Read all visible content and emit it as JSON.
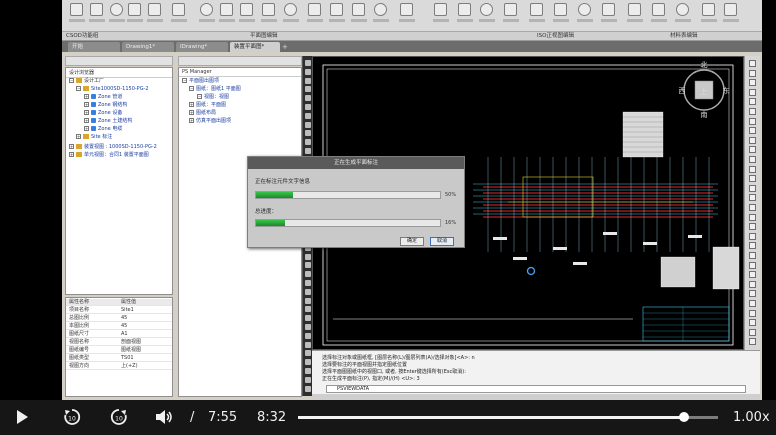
{
  "ribbon": {
    "groups": [
      "CSOD功能组",
      "平面图编辑",
      "ISO正视图编辑",
      "材料表编辑"
    ]
  },
  "tabs": [
    {
      "label": "开始"
    },
    {
      "label": "Drawing1*"
    },
    {
      "label": "IDrawing*"
    },
    {
      "label": "装置平面图*"
    }
  ],
  "tree1": {
    "title": "设计浏览器",
    "nodes": [
      {
        "label": "设计工厂"
      },
      {
        "label": "Site1000SD-1150-PG-2"
      },
      {
        "label": "Zone 管道"
      },
      {
        "label": "Zone 钢结构"
      },
      {
        "label": "Zone 设备"
      },
      {
        "label": "Zone 土建结构"
      },
      {
        "label": "Zone 电缆"
      },
      {
        "label": "Site 标注"
      },
      {
        "label": "装置视图 : 1000SD-1150-PG-2"
      },
      {
        "label": "单元视图：合同1 装置平面图"
      }
    ]
  },
  "tree2": {
    "title": "PS Manager",
    "nodes": [
      {
        "label": "平面图出图项"
      },
      {
        "label": "图纸：图纸1 平面图"
      },
      {
        "label": "视图：视图"
      },
      {
        "label": "图纸：平面图"
      },
      {
        "label": "图纸布局"
      },
      {
        "label": "仿真平面出图项"
      }
    ]
  },
  "props": {
    "header": [
      "属性名称",
      "属性值"
    ],
    "rows": [
      [
        "项目名称",
        "Site1"
      ],
      [
        "总图比例",
        "45"
      ],
      [
        "本图比例",
        "45"
      ],
      [
        "图纸尺寸",
        "A1"
      ],
      [
        "视图名称",
        "剖面视图"
      ],
      [
        "图纸编号",
        "图纸视图"
      ],
      [
        "图纸类型",
        "TS01"
      ],
      [
        "视图方向",
        "上(+Z)"
      ]
    ]
  },
  "viewcube": {
    "top": "北",
    "center": "上",
    "left": "西",
    "right": "东",
    "bottom": "南"
  },
  "dialog": {
    "title": "正在生成平面标注",
    "task_label": "正在标注元件文字信息",
    "task_pct": "50%",
    "task_progress": 0.2,
    "overall_label": "总进度：",
    "overall_pct": "16%",
    "overall_progress": 0.16,
    "btn_ok": "确定",
    "btn_cancel": "取消"
  },
  "command": {
    "lines": [
      "选择标注对象或图纸框, [图层名称(L)/图层列表(A)/选择对象]<A>: n",
      "选择要标注的平面视图并指定图纸位置",
      "选择平面图图纸中的视图口, 或者, 按Enter键选择所有(Esc取消):",
      "正在生成平面标注(P), 指定(M)/(H) <U>: 3"
    ],
    "prompt": "PSVIEWDATA"
  },
  "player": {
    "time_sep": "/",
    "total_time": "7:55",
    "current_time": "8:32",
    "progress": 0.92,
    "speed": "1.00x"
  },
  "colors": {
    "canvas_bg": "#000000",
    "cad_cyan": "#3ec7e8",
    "cad_red": "#e8262a",
    "cad_yellow": "#e8d22a",
    "progress_green": "#2bb33c",
    "player_bg": "#181818"
  }
}
